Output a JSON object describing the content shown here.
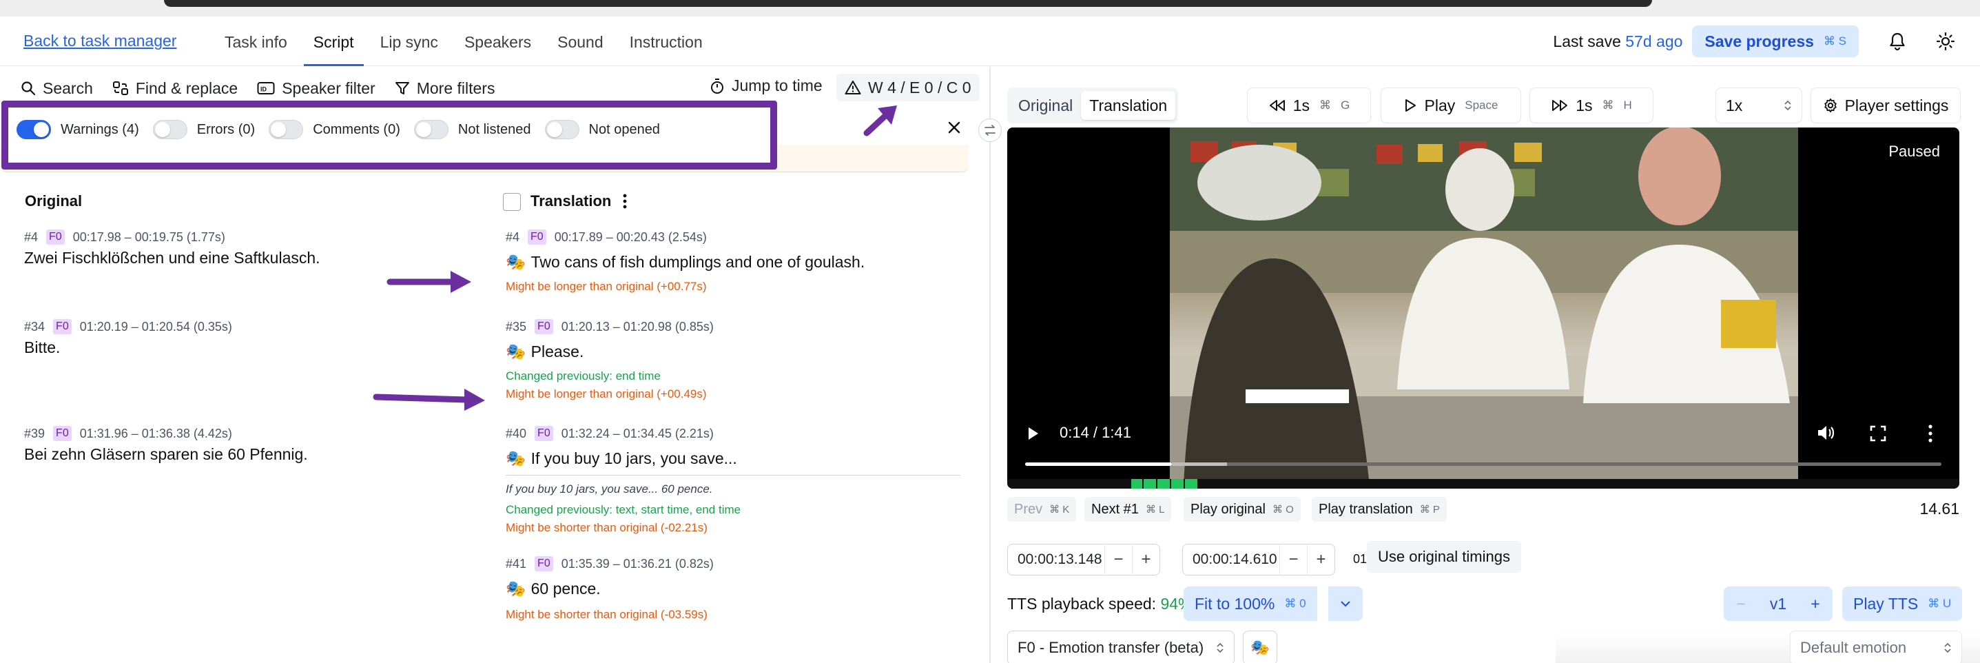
{
  "header": {
    "back_link": "Back to task manager",
    "tabs": [
      {
        "label": "Task info",
        "active": false
      },
      {
        "label": "Script",
        "active": true
      },
      {
        "label": "Lip sync",
        "active": false
      },
      {
        "label": "Speakers",
        "active": false
      },
      {
        "label": "Sound",
        "active": false
      },
      {
        "label": "Instruction",
        "active": false
      }
    ],
    "last_save_label": "Last save",
    "last_save_ago": "57d ago",
    "save_button": "Save progress",
    "save_shortcut": "⌘ S"
  },
  "toolbar": {
    "search": "Search",
    "find_replace": "Find & replace",
    "speaker_filter": "Speaker filter",
    "more_filters": "More filters",
    "jump_to_time": "Jump to time",
    "counts": "W 4 / E 0 / C 0"
  },
  "filters": [
    {
      "label": "Warnings (4)",
      "on": true
    },
    {
      "label": "Errors (0)",
      "on": false
    },
    {
      "label": "Comments (0)",
      "on": false
    },
    {
      "label": "Not listened",
      "on": false
    },
    {
      "label": "Not opened",
      "on": false
    }
  ],
  "columns": {
    "original": "Original",
    "translation": "Translation"
  },
  "original_rows": [
    {
      "num": "#4",
      "speaker": "F0",
      "time": "00:17.98 – 00:19.75 (1.77s)",
      "text": "Zwei Fischklößchen und eine Saftkulasch."
    },
    {
      "num": "#34",
      "speaker": "F0",
      "time": "01:20.19 – 01:20.54 (0.35s)",
      "text": "Bitte."
    },
    {
      "num": "#39",
      "speaker": "F0",
      "time": "01:31.96 – 01:36.38 (4.42s)",
      "text": "Bei zehn Gläsern sparen sie 60 Pfennig."
    }
  ],
  "translation_rows": [
    {
      "num": "#4",
      "speaker": "F0",
      "time": "00:17.89 – 00:20.43 (2.54s)",
      "text": "Two cans of fish dumplings and one of goulash.",
      "notes": [
        {
          "kind": "orange",
          "text": "Might be longer than original (+00.77s)"
        }
      ]
    },
    {
      "num": "#35",
      "speaker": "F0",
      "time": "01:20.13 – 01:20.98 (0.85s)",
      "text": "Please.",
      "notes": [
        {
          "kind": "green",
          "text": "Changed previously: end time"
        },
        {
          "kind": "orange",
          "text": "Might be longer than original (+00.49s)"
        }
      ]
    },
    {
      "num": "#40",
      "speaker": "F0",
      "time": "01:32.24 – 01:34.45 (2.21s)",
      "text": "If you buy 10 jars, you save...",
      "italic": "If you buy 10 jars, you save... 60 pence.",
      "notes": [
        {
          "kind": "green",
          "text": "Changed previously: text, start time, end time"
        },
        {
          "kind": "orange",
          "text": "Might be shorter than original (-02.21s)"
        }
      ]
    },
    {
      "num": "#41",
      "speaker": "F0",
      "time": "01:35.39 – 01:36.21 (0.82s)",
      "text": "60 pence.",
      "notes": [
        {
          "kind": "orange",
          "text": "Might be shorter than original (-03.59s)"
        }
      ]
    }
  ],
  "player": {
    "mode_tabs": [
      "Original",
      "Translation"
    ],
    "active_mode": "Translation",
    "back_label": "1s",
    "back_kbd_1": "⌘",
    "back_kbd_2": "G",
    "play_label": "Play",
    "play_kbd": "Space",
    "fwd_label": "1s",
    "fwd_kbd_1": "⌘",
    "fwd_kbd_2": "H",
    "speed": "1x",
    "settings": "Player settings",
    "paused": "Paused",
    "video_time": "0:14 / 1:41",
    "progress_fraction": 0.16
  },
  "segnav": {
    "prev": "Prev",
    "prev_kbd": "⌘ K",
    "next": "Next #1",
    "next_kbd": "⌘ L",
    "play_original": "Play original",
    "play_original_kbd": "⌘ O",
    "play_translation": "Play translation",
    "play_translation_kbd": "⌘ P",
    "right_value": "14.61"
  },
  "timing": {
    "start": "00:00:13.148",
    "end": "00:00:14.610",
    "duration": "01.46s",
    "use_original": "Use original timings"
  },
  "tts": {
    "speed_label": "TTS playback speed:",
    "speed_value": "94%",
    "fit_button": "Fit to 100%",
    "fit_kbd": "⌘ 0",
    "version": "v1",
    "play_tts": "Play TTS",
    "play_tts_kbd": "⌘ U"
  },
  "voice": {
    "model": "F0 - Emotion transfer (beta)",
    "emotion": "Default emotion"
  },
  "colors": {
    "accent": "#2563eb",
    "annotation": "#6b2fa0",
    "warning": "#ea580c",
    "changed": "#16a34a"
  }
}
